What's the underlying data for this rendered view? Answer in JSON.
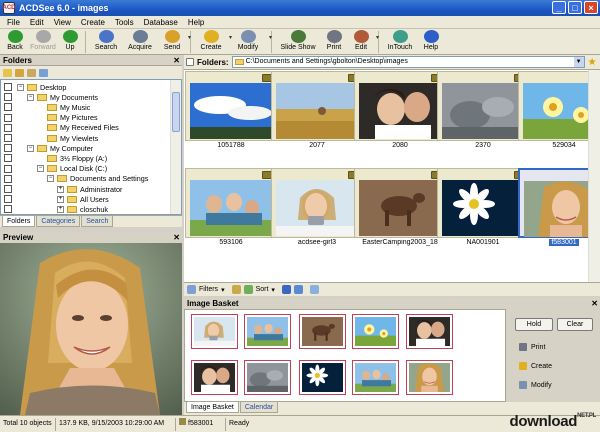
{
  "window": {
    "title": "ACDSee 6.0 - images",
    "app_icon_text": "ACD"
  },
  "menu": [
    "File",
    "Edit",
    "View",
    "Create",
    "Tools",
    "Database",
    "Help"
  ],
  "toolbar": [
    {
      "label": "Back",
      "icon": "back-icon",
      "color": "#2e9b32"
    },
    {
      "label": "Forward",
      "icon": "forward-icon",
      "color": "#a8a8a8",
      "disabled": true
    },
    {
      "label": "Up",
      "icon": "up-icon",
      "color": "#2e9b32"
    },
    {
      "label": "Search",
      "icon": "search-icon",
      "color": "#4a74c8"
    },
    {
      "label": "Acquire",
      "icon": "acquire-icon",
      "color": "#6a7c96"
    },
    {
      "label": "Send",
      "icon": "send-icon",
      "color": "#d9a02a"
    },
    {
      "label": "Create",
      "icon": "create-icon",
      "color": "#e0b020"
    },
    {
      "label": "Modify",
      "icon": "modify-icon",
      "color": "#7b8fb0"
    },
    {
      "label": "Slide Show",
      "icon": "slideshow-icon",
      "color": "#4a7a3a"
    },
    {
      "label": "Print",
      "icon": "print-icon",
      "color": "#6f7582"
    },
    {
      "label": "Edit",
      "icon": "edit-icon",
      "color": "#b05a3a"
    },
    {
      "label": "InTouch",
      "icon": "intouch-icon",
      "color": "#3e9e8a"
    },
    {
      "label": "Help",
      "icon": "help-icon",
      "color": "#2d5ec9"
    }
  ],
  "folders_panel": {
    "title": "Folders",
    "tree": [
      {
        "label": "Desktop",
        "depth": 0,
        "expanded": true
      },
      {
        "label": "My Documents",
        "depth": 1,
        "expanded": true
      },
      {
        "label": "My Music",
        "depth": 2
      },
      {
        "label": "My Pictures",
        "depth": 2
      },
      {
        "label": "My Received Files",
        "depth": 2
      },
      {
        "label": "My Viewlets",
        "depth": 2
      },
      {
        "label": "My Computer",
        "depth": 1,
        "expanded": true
      },
      {
        "label": "3½ Floppy (A:)",
        "depth": 2
      },
      {
        "label": "Local Disk (C:)",
        "depth": 2,
        "expanded": true
      },
      {
        "label": "Documents and Settings",
        "depth": 3,
        "expanded": true
      },
      {
        "label": "Administrator",
        "depth": 4
      },
      {
        "label": "All Users",
        "depth": 4
      },
      {
        "label": "closchuk",
        "depth": 4
      }
    ],
    "tabs": [
      "Folders",
      "Categories",
      "Search"
    ]
  },
  "preview_panel": {
    "title": "Preview"
  },
  "address": {
    "label": "Folders:",
    "path": "C:\\Documents and Settings\\gbolton\\Desktop\\images"
  },
  "files": [
    {
      "name": "1051788",
      "scene": "sky"
    },
    {
      "name": "2077",
      "scene": "field"
    },
    {
      "name": "2080",
      "scene": "couple"
    },
    {
      "name": "2370",
      "scene": "rocks"
    },
    {
      "name": "529034",
      "scene": "flowers"
    },
    {
      "name": "593106",
      "scene": "family"
    },
    {
      "name": "acdsee-girl3",
      "scene": "girl-camera"
    },
    {
      "name": "EasterCamping2003_18",
      "scene": "horses"
    },
    {
      "name": "NA001901",
      "scene": "daisy"
    },
    {
      "name": "f583001",
      "scene": "portrait",
      "selected": true
    }
  ],
  "filterbar": {
    "filters": "Filters",
    "sort": "Sort"
  },
  "basket": {
    "title": "Image Basket",
    "hold": "Hold",
    "clear": "Clear",
    "actions": [
      "Print",
      "Create",
      "Modify"
    ],
    "tabs": [
      "Image Basket",
      "Calendar"
    ]
  },
  "status": {
    "total": "Total 10 objects",
    "info": "137.9 KB, 9/15/2003 10:29:00 AM",
    "file": "f583001",
    "state": "Ready"
  },
  "watermark": {
    "text": "download",
    "suffix": "NET.PL"
  }
}
